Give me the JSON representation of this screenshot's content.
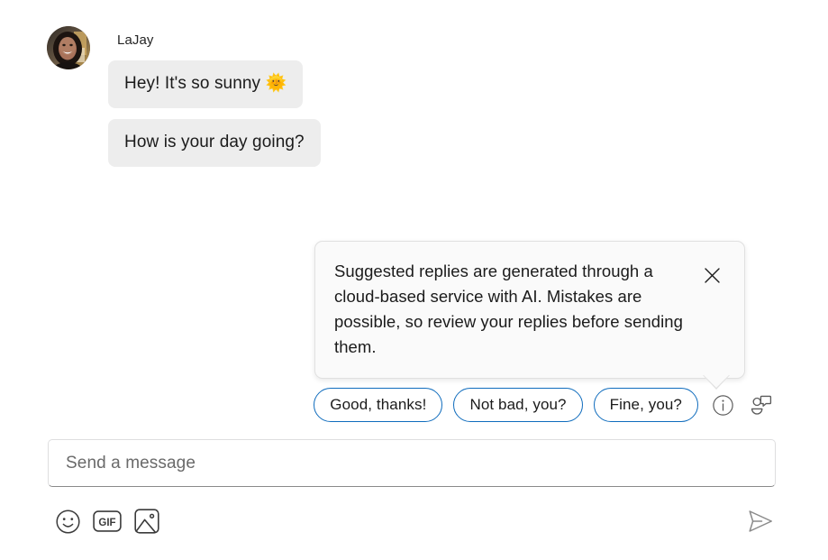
{
  "conversation": {
    "sender_name": "LaJay",
    "avatar": {
      "icon": "user-avatar-photo",
      "alt": "LaJay profile photo"
    },
    "messages": [
      {
        "text": "Hey! It's so sunny 🌞",
        "from": "LaJay"
      },
      {
        "text": "How is your day going?",
        "from": "LaJay"
      }
    ]
  },
  "callout": {
    "text": "Suggested replies are generated through a cloud-based service with AI. Mistakes are possible, so review your replies before sending them.",
    "close_icon": "close-icon",
    "close_label": "Close"
  },
  "suggested_replies": {
    "chips": [
      {
        "label": "Good, thanks!"
      },
      {
        "label": "Not bad, you?"
      },
      {
        "label": "Fine, you?"
      }
    ],
    "info_icon": "info-icon",
    "toggle_icon": "suggested-replies-icon",
    "accent_color": "#0f6cbd"
  },
  "composer": {
    "placeholder": "Send a message",
    "value": "",
    "tools": [
      {
        "name": "emoji-icon",
        "label": "Emoji"
      },
      {
        "name": "gif-icon",
        "label": "GIF"
      },
      {
        "name": "image-icon",
        "label": "Image"
      }
    ],
    "send": {
      "icon": "send-icon",
      "label": "Send"
    }
  },
  "theme": {
    "background": "#ffffff",
    "bubble_background": "#ededed",
    "text_color": "#1b1b1b",
    "callout_background": "#fafafa",
    "callout_border": "#e0e0e0",
    "icon_color": "#3b3b3b"
  }
}
